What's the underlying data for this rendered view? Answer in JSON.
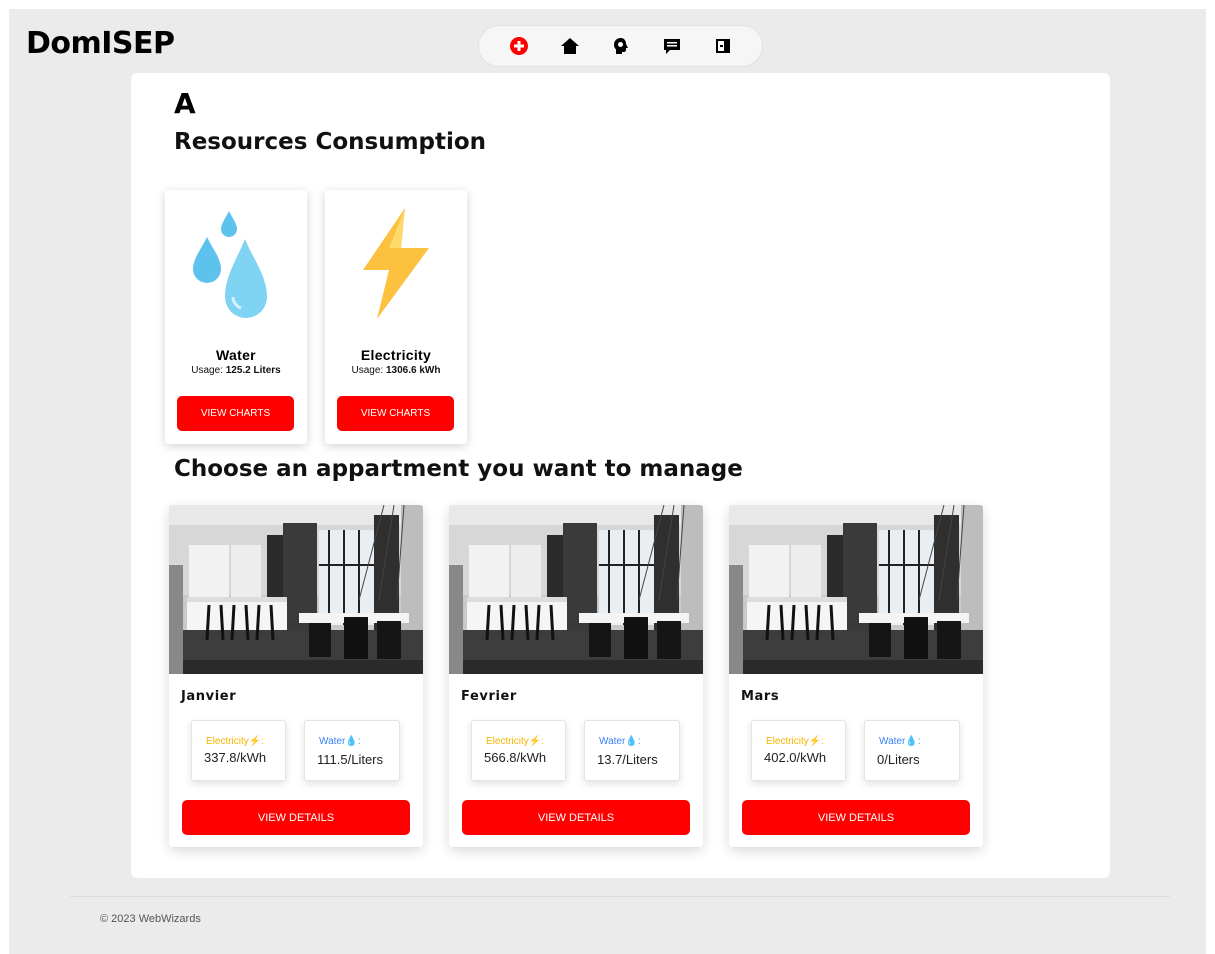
{
  "app": {
    "brand": "DomISEP"
  },
  "navbar": {
    "items": [
      {
        "icon": "add-circle-icon",
        "color": "#ff0000"
      },
      {
        "icon": "home-icon"
      },
      {
        "icon": "head-idea-icon"
      },
      {
        "icon": "message-icon"
      },
      {
        "icon": "logout-icon"
      }
    ]
  },
  "building": {
    "name": "A"
  },
  "resources": {
    "heading": "Resources Consumption",
    "usage_label": "Usage:",
    "items": [
      {
        "name": "Water",
        "usage": "125.2 Liters",
        "button": "VIEW CHARTS",
        "icon": "water-drops-icon"
      },
      {
        "name": "Electricity",
        "usage": "1306.6 kWh",
        "button": "VIEW CHARTS",
        "icon": "lightning-icon"
      }
    ]
  },
  "apartments": {
    "heading": "Choose an appartment you want to manage",
    "electricity_label": "Electricity",
    "water_label": "Water",
    "button": "VIEW DETAILS",
    "items": [
      {
        "name": "Janvier",
        "electricity": "337.8/kWh",
        "water": "111.5/Liters"
      },
      {
        "name": "Fevrier",
        "electricity": "566.8/kWh",
        "water": "13.7/Liters"
      },
      {
        "name": "Mars",
        "electricity": "402.0/kWh",
        "water": "0/Liters"
      }
    ]
  },
  "footer": {
    "copyright": "© 2023 WebWizards"
  },
  "colors": {
    "accent": "#ff0000",
    "electricity": "#f4b400",
    "water": "#3b82f6",
    "background": "#ebebeb"
  }
}
